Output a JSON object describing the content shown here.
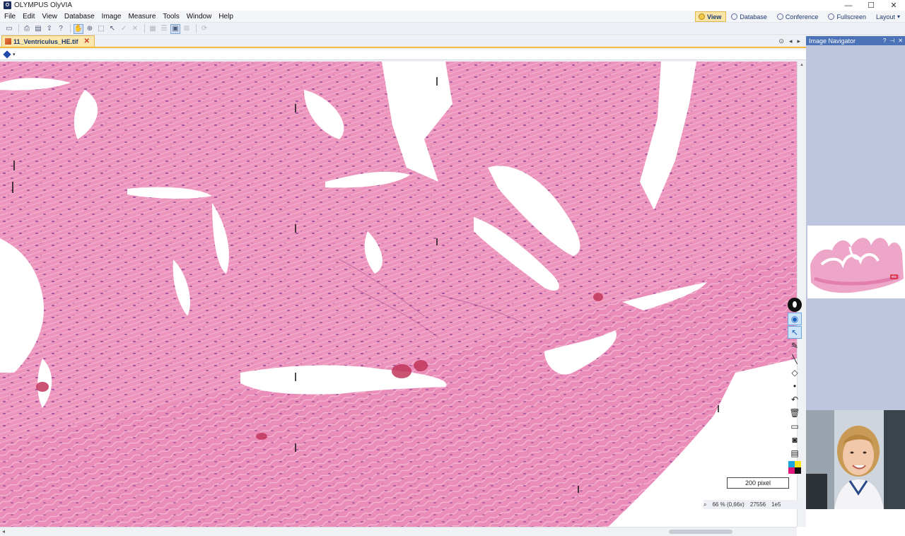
{
  "window": {
    "title": "OLYMPUS OlyVIA",
    "app_icon_letter": "O",
    "controls": [
      "—",
      "☐",
      "✕"
    ]
  },
  "menu": {
    "items": [
      "File",
      "Edit",
      "View",
      "Database",
      "Image",
      "Measure",
      "Tools",
      "Window",
      "Help"
    ]
  },
  "modes": {
    "view": "View",
    "database": "Database",
    "conference": "Conference",
    "fullscreen": "Fullscreen",
    "layout": "Layout"
  },
  "document": {
    "tab_label": "11_Ventriculus_HE.tif",
    "tab_close": "✕"
  },
  "scalebar": {
    "label": "200 pixel"
  },
  "status": {
    "zoom": "66 % (0,66x)",
    "coord_x": "27556",
    "coord_y": "1e5"
  },
  "navigator": {
    "title": "Image Navigator",
    "buttons": [
      "?",
      "✕"
    ]
  },
  "colors": {
    "accent": "#f0b93a",
    "panel_header": "#4c73b8",
    "stain_pink": "#e98fb8",
    "tissue_light": "#f1a9c8",
    "nuclei": "#8a3a8c"
  }
}
